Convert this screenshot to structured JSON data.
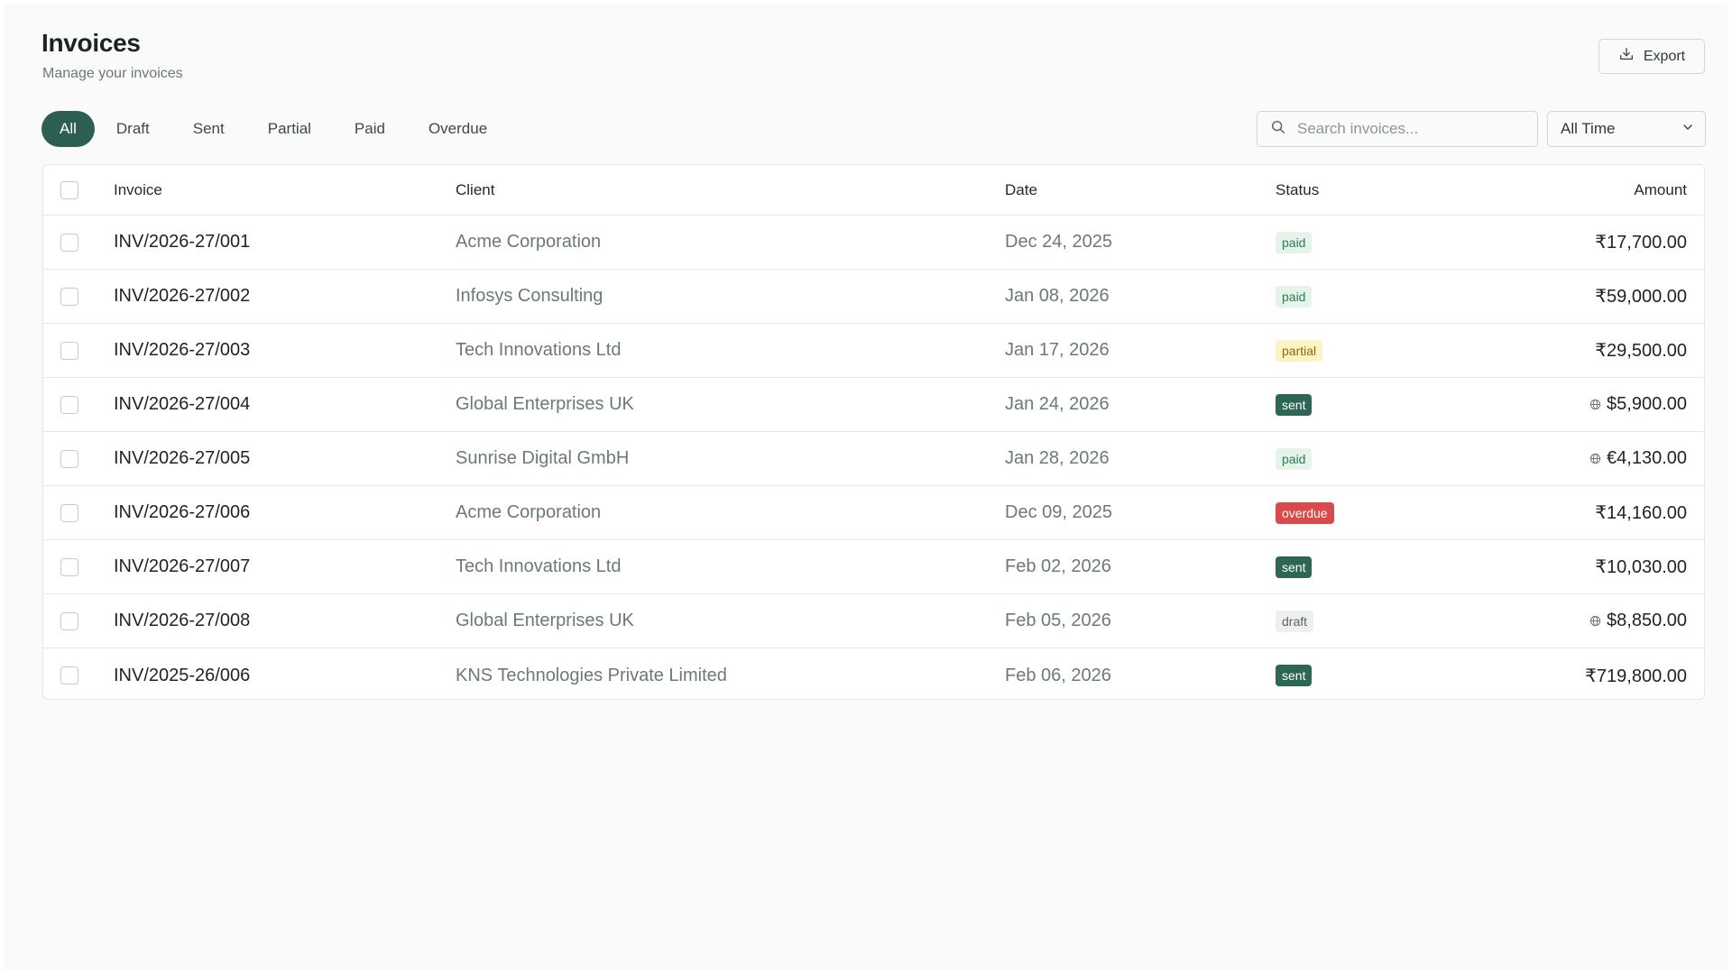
{
  "header": {
    "title": "Invoices",
    "subtitle": "Manage your invoices",
    "export_label": "Export"
  },
  "filters": {
    "tabs": [
      {
        "label": "All",
        "active": true
      },
      {
        "label": "Draft",
        "active": false
      },
      {
        "label": "Sent",
        "active": false
      },
      {
        "label": "Partial",
        "active": false
      },
      {
        "label": "Paid",
        "active": false
      },
      {
        "label": "Overdue",
        "active": false
      }
    ],
    "search_placeholder": "Search invoices...",
    "search_value": "",
    "date_range": "All Time"
  },
  "table": {
    "columns": {
      "invoice": "Invoice",
      "client": "Client",
      "date": "Date",
      "status": "Status",
      "amount": "Amount"
    },
    "rows": [
      {
        "invoice": "INV/2026-27/001",
        "client": "Acme Corporation",
        "date": "Dec 24, 2025",
        "status": "paid",
        "amount": "₹17,700.00",
        "foreign": false
      },
      {
        "invoice": "INV/2026-27/002",
        "client": "Infosys Consulting",
        "date": "Jan 08, 2026",
        "status": "paid",
        "amount": "₹59,000.00",
        "foreign": false
      },
      {
        "invoice": "INV/2026-27/003",
        "client": "Tech Innovations Ltd",
        "date": "Jan 17, 2026",
        "status": "partial",
        "amount": "₹29,500.00",
        "foreign": false
      },
      {
        "invoice": "INV/2026-27/004",
        "client": "Global Enterprises UK",
        "date": "Jan 24, 2026",
        "status": "sent",
        "amount": "$5,900.00",
        "foreign": true
      },
      {
        "invoice": "INV/2026-27/005",
        "client": "Sunrise Digital GmbH",
        "date": "Jan 28, 2026",
        "status": "paid",
        "amount": "€4,130.00",
        "foreign": true
      },
      {
        "invoice": "INV/2026-27/006",
        "client": "Acme Corporation",
        "date": "Dec 09, 2025",
        "status": "overdue",
        "amount": "₹14,160.00",
        "foreign": false
      },
      {
        "invoice": "INV/2026-27/007",
        "client": "Tech Innovations Ltd",
        "date": "Feb 02, 2026",
        "status": "sent",
        "amount": "₹10,030.00",
        "foreign": false
      },
      {
        "invoice": "INV/2026-27/008",
        "client": "Global Enterprises UK",
        "date": "Feb 05, 2026",
        "status": "draft",
        "amount": "$8,850.00",
        "foreign": true
      },
      {
        "invoice": "INV/2025-26/006",
        "client": "KNS Technologies Private Limited",
        "date": "Feb 06, 2026",
        "status": "sent",
        "amount": "₹719,800.00",
        "foreign": false
      }
    ]
  },
  "colors": {
    "accent": "#2d5e52",
    "paid_bg": "#e5f3ea",
    "partial_bg": "#fdf4c4",
    "sent_bg": "#2d6655",
    "overdue_bg": "#d94a4a",
    "draft_bg": "#eef0ef"
  },
  "icons": {
    "export": "download-tray-icon",
    "search": "search-icon",
    "dropdown": "chevron-down-icon",
    "foreign_currency": "globe-icon"
  }
}
